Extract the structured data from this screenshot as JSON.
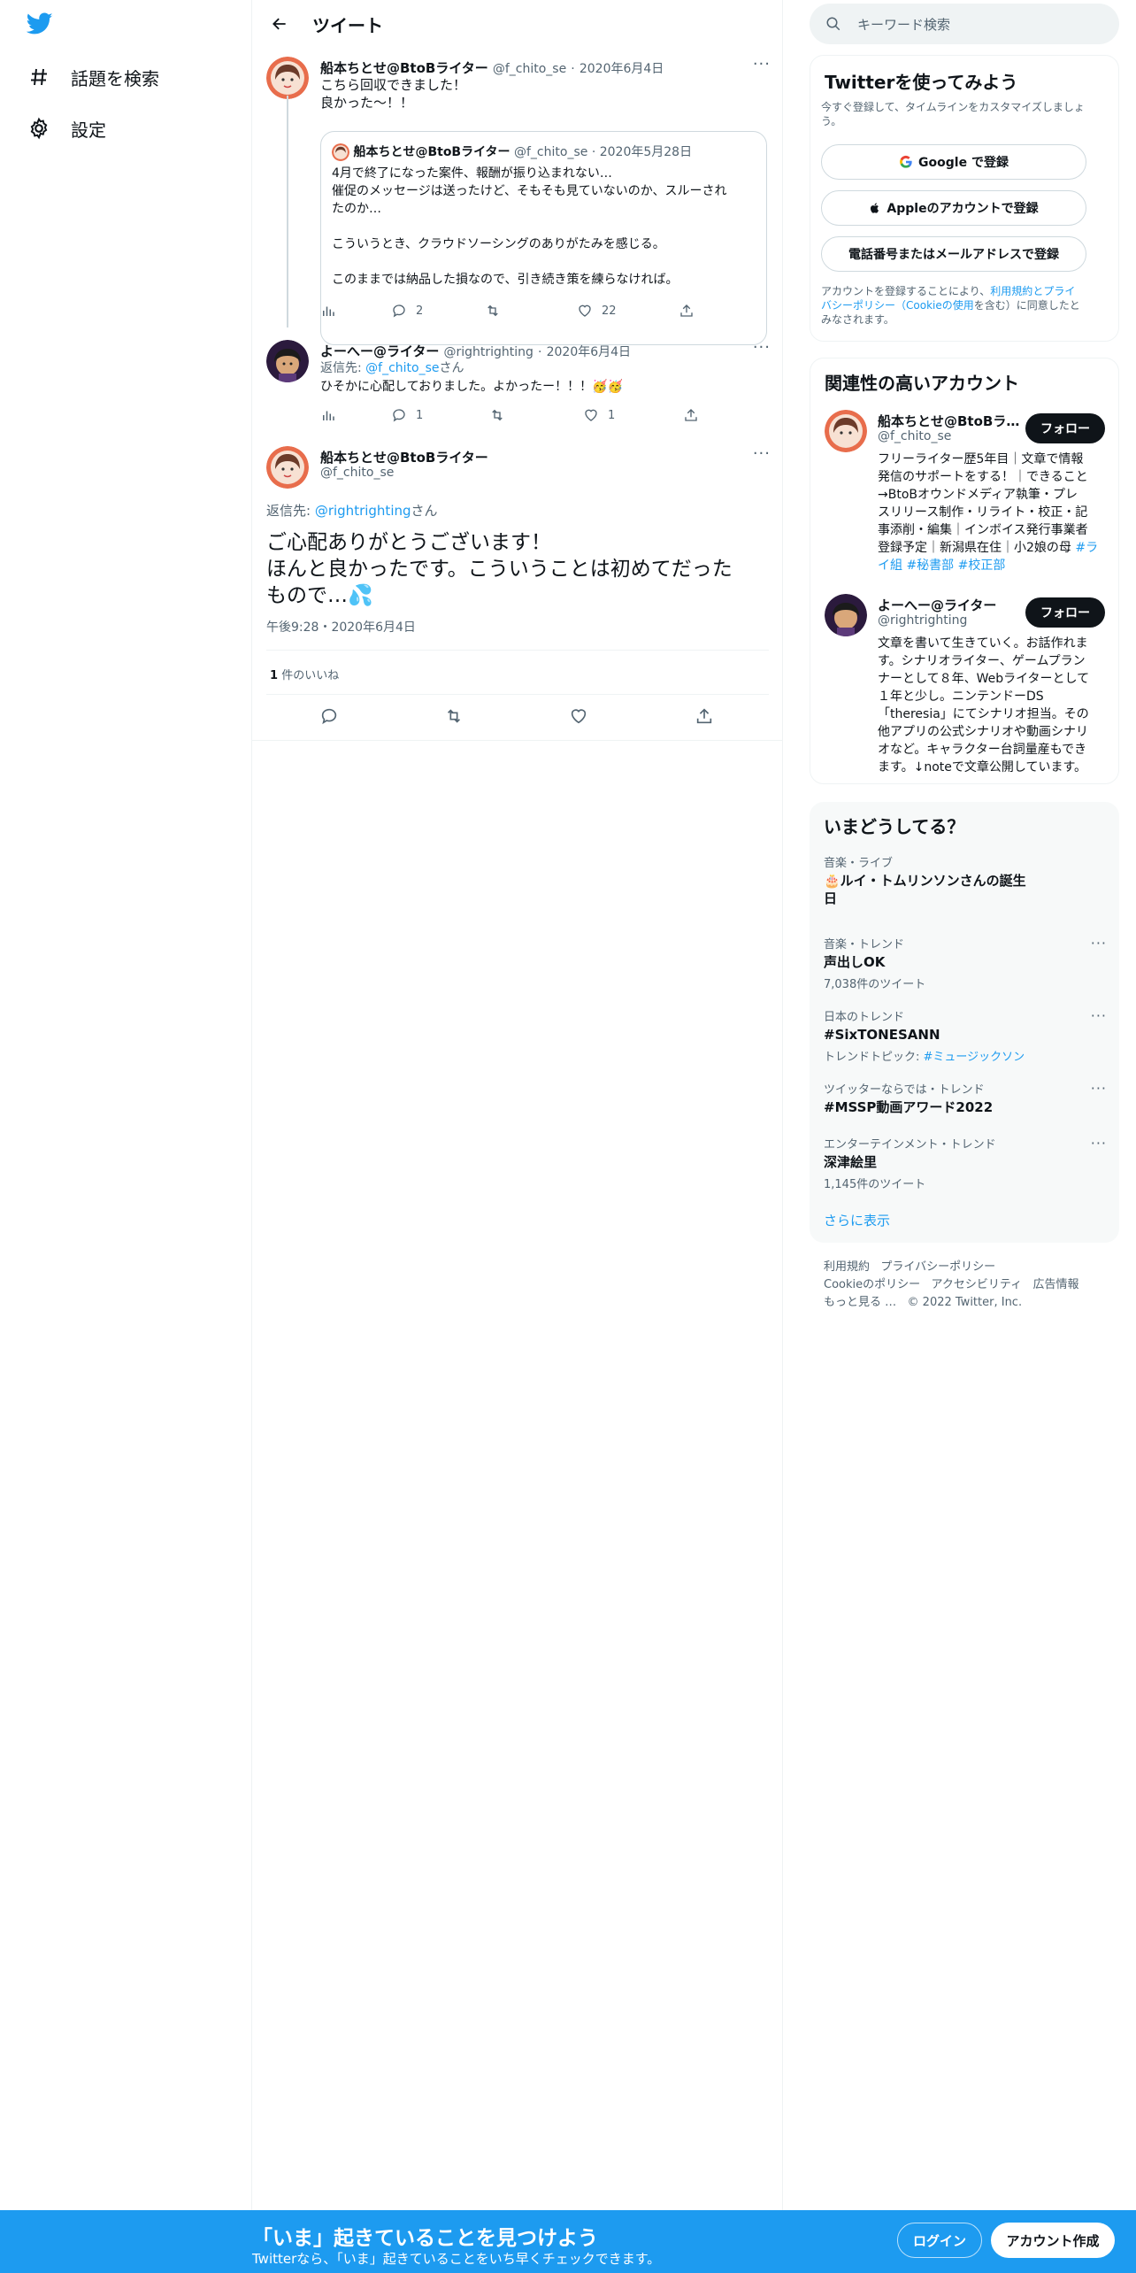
{
  "nav": {
    "explore": "話題を検索",
    "settings": "設定"
  },
  "header": {
    "title": "ツイート"
  },
  "thread": {
    "tweet1": {
      "name": "船本ちとせ@BtoBライター",
      "handle": "@f_chito_se",
      "date": "2020年6月4日",
      "lines": [
        "こちら回収できました！",
        "良かった～！！"
      ],
      "quote": {
        "name": "船本ちとせ@BtoBライター",
        "handle": "@f_chito_se",
        "date": "2020年5月28日",
        "lines": [
          "4月で終了になった案件、報酬が振り込まれない…",
          "催促のメッセージは送ったけど、そもそも見ていないのか、スルーされ",
          "たのか…",
          "",
          "こういうとき、クラウドソーシングのありがたみを感じる。",
          "",
          "このままでは納品した損なので、引き続き策を練らなければ。"
        ]
      },
      "replies": "2",
      "likes": "22"
    },
    "tweet2": {
      "name": "よーへー@ライター",
      "handle": "@rightrighting",
      "date": "2020年6月4日",
      "reply_prefix": "返信先: ",
      "reply_to": "@f_chito_se",
      "reply_suffix": "さん",
      "text": "ひそかに心配しておりました。よかったー！！！🥳🥳",
      "replies": "1",
      "likes": "1"
    },
    "main_tweet": {
      "name": "船本ちとせ@BtoBライター",
      "handle": "@f_chito_se",
      "reply_prefix": "返信先: ",
      "reply_to": "@rightrighting",
      "reply_suffix": "さん",
      "lines": [
        "ご心配ありがとうございます！",
        "ほんと良かったです。こういうことは初めてだった",
        "もので…💦"
      ],
      "time": "午後9:28・2020年6月4日",
      "likes_count": "1",
      "likes_label": "件のいいね"
    }
  },
  "sidebar": {
    "search_placeholder": "キーワード検索",
    "signup": {
      "title": "Twitterを使ってみよう",
      "subtitle_1": "今すぐ登録して、タイムラインをカスタマイズしましょ",
      "subtitle_2": "う。",
      "google": "Google で登録",
      "apple": "Appleのアカウントで登録",
      "phone": "電話番号またはメールアドレスで登録",
      "legal_1a": "アカウントを登録することにより、",
      "legal_1b": "利用規約",
      "legal_1c": "と",
      "legal_1d": "プライ",
      "legal_2a": "バシーポリシー（Cookieの使用",
      "legal_2b": "を含む）に同意したと",
      "legal_3": "みなされます。"
    },
    "relevant": {
      "title": "関連性の高いアカウント",
      "follow_label": "フォロー",
      "accounts": [
        {
          "name": "船本ちとせ@BtoBラ…",
          "handle": "@f_chito_se",
          "bio": [
            "フリーライター歴5年目｜文章で情報",
            "発信のサポートをする！｜できること",
            "→BtoBオウンドメディア執筆・プレ",
            "スリリース制作・リライト・校正・記",
            "事添削・編集｜インボイス発行事業者",
            "登録予定｜新潟県在住｜小2娘の母 "
          ],
          "bio_tags": [
            "#ラ",
            "イ組",
            "#秘書部",
            "#校正部"
          ]
        },
        {
          "name": "よーへー@ライター",
          "handle": "@rightrighting",
          "bio": [
            "文章を書いて生きていく。お話作れま",
            "す。シナリオライター、ゲームプラン",
            "ナーとして８年、Webライターとして",
            "１年と少し。ニンテンドーDS",
            "「theresia」にてシナリオ担当。その",
            "他アプリの公式シナリオや動画シナリ",
            "オなど。キャラクター台詞量産もでき",
            "ます。↓noteで文章公開しています。"
          ]
        }
      ]
    },
    "trends": {
      "title": "いまどうしてる？",
      "items": [
        {
          "category": "音楽・ライブ",
          "title_1": "🎂ルイ・トムリンソンさんの誕生",
          "title_2": "日"
        },
        {
          "category": "音楽・トレンド",
          "title": "声出しOK",
          "count": "7,038件のツイート"
        },
        {
          "category": "日本のトレンド",
          "title": "#SixTONESANN",
          "topic_label": "トレンドトピック: ",
          "topic": "#ミュージックソン"
        },
        {
          "category": "ツイッターならでは・トレンド",
          "title": "#MSSP動画アワード2022"
        },
        {
          "category": "エンターテインメント・トレンド",
          "title": "深津絵里",
          "count": "1,145件のツイート"
        }
      ],
      "show_more": "さらに表示"
    },
    "footer": {
      "terms": "利用規約",
      "privacy": "プライバシーポリシー",
      "cookies": "Cookieのポリシー",
      "accessibility": "アクセシビリティ",
      "ads": "広告情報",
      "more": "もっと見る …",
      "copyright": "© 2022 Twitter, Inc."
    }
  },
  "banner": {
    "headline": "「いま」起きていることを見つけよう",
    "sub": "Twitterなら、「いま」起きていることをいち早くチェックできます。",
    "login": "ログイン",
    "signup": "アカウント作成"
  }
}
